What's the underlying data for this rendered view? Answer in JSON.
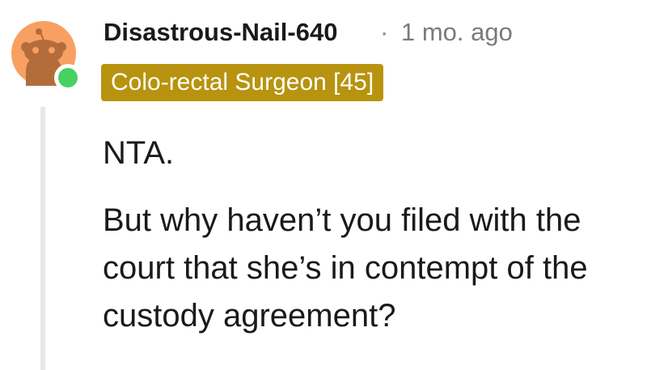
{
  "comment": {
    "username": "Disastrous-Nail-640",
    "separator": "·",
    "timestamp": "1 mo. ago",
    "flair": "Colo-rectal Surgeon [45]",
    "paragraphs": [
      "NTA.",
      "But why haven’t you filed with the court that she’s in contempt of the custody agreement?"
    ]
  },
  "colors": {
    "avatar_bg": "#f7a061",
    "online_status": "#46d160",
    "flair_bg": "#b7930f",
    "thread_line": "#e8e8e8"
  },
  "icons": {
    "avatar": "snoo-avatar-icon",
    "status": "online-status-icon"
  }
}
